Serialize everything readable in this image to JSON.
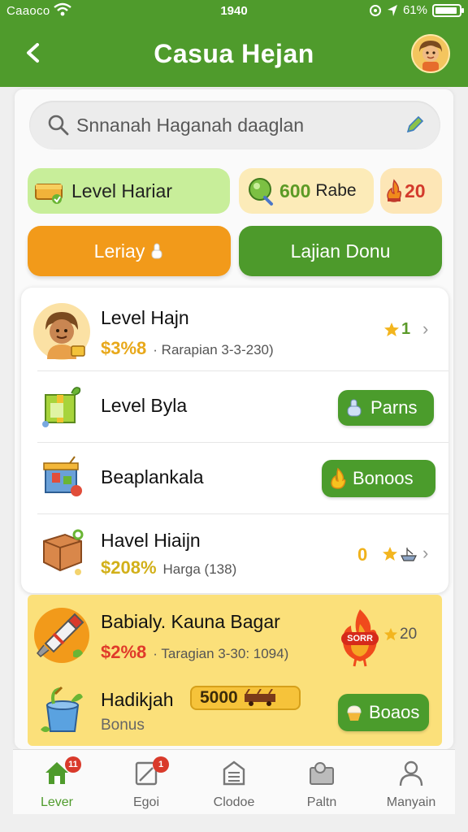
{
  "status_bar": {
    "carrier": "Caaoco",
    "time": "1940",
    "battery": "61%"
  },
  "header": {
    "title": "Casua Hejan"
  },
  "search": {
    "placeholder": "Snnanah Haganah daaglan"
  },
  "stats": {
    "level_label": "Level Hariar",
    "coins_value": "600",
    "coins_label": "Rabe",
    "streak_value": "20"
  },
  "actions": {
    "primary_label": "Leriay",
    "secondary_label": "Lajian Donu"
  },
  "list": {
    "items": [
      {
        "name": "Level Hajn",
        "price": "$3%8",
        "detail": "· Rarapian 3-3-230)",
        "rating": "1"
      },
      {
        "name": "Level Byla",
        "button_label": "Parns"
      },
      {
        "name": "Beaplankala",
        "button_label": "Bonoos"
      },
      {
        "name": "Havel Hiaijn",
        "price": "$208%",
        "detail": "Harga (138)",
        "count": "0"
      }
    ]
  },
  "promo": {
    "title": "Babialy. Kauna Bagar",
    "price": "$2%8",
    "detail": "· Taragian 3-30: 1094)",
    "badge": "SORR",
    "rating": "20",
    "bonus_name": "Hadikjah",
    "bonus_amount": "5000",
    "bonus_sub": "Bonus",
    "bonus_button": "Boaos"
  },
  "tabs": [
    {
      "label": "Lever",
      "icon": "home-icon",
      "badge": "11",
      "active": true
    },
    {
      "label": "Egoi",
      "icon": "edit-icon",
      "badge": "1"
    },
    {
      "label": "Clodoe",
      "icon": "building-icon"
    },
    {
      "label": "Paltn",
      "icon": "profile-card-icon"
    },
    {
      "label": "Manyain",
      "icon": "user-icon"
    }
  ],
  "colors": {
    "header_green": "#4f9b2c",
    "orange": "#f29a1a",
    "gold": "#e8a81a",
    "promo_yellow": "#fbe07a"
  }
}
